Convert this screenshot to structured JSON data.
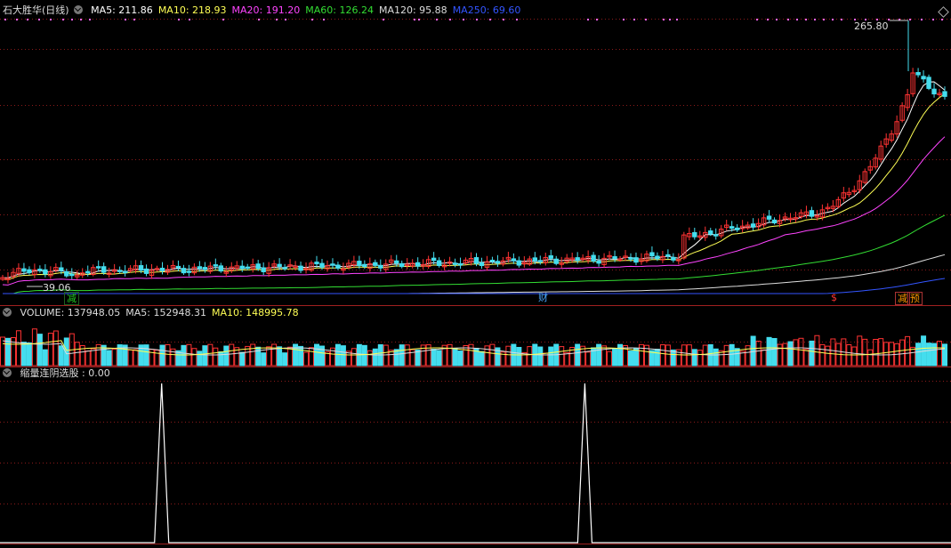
{
  "main_panel": {
    "title": "石大胜华(日线)",
    "indicators": [
      {
        "label": "MA5: 211.86",
        "color": "#ffffff"
      },
      {
        "label": "MA10: 218.93",
        "color": "#ffff55"
      },
      {
        "label": "MA20: 191.20",
        "color": "#ff44ff"
      },
      {
        "label": "MA60: 126.24",
        "color": "#33dd33"
      },
      {
        "label": "MA120: 95.88",
        "color": "#dddddd"
      },
      {
        "label": "MA250: 69.60",
        "color": "#3355ff"
      }
    ],
    "high_label": "265.80",
    "low_label": "39.06",
    "markers": [
      {
        "text": "减",
        "color": "#22cc22"
      },
      {
        "text": "财",
        "color": "#4aa8ff"
      },
      {
        "text": "$",
        "color": "#ff3333"
      },
      {
        "text": "减",
        "color": "#ff9900"
      },
      {
        "text": "预",
        "color": "#ff9900"
      }
    ]
  },
  "volume_panel": {
    "indicators": [
      {
        "label": "VOLUME: 137948.05",
        "color": "#dddddd"
      },
      {
        "label": "MA5: 152948.31",
        "color": "#dddddd"
      },
      {
        "label": "MA10: 148995.78",
        "color": "#ffff55"
      }
    ]
  },
  "signal_panel": {
    "label": "缩量连阴选股 : 0.00",
    "spikes": [
      0.17,
      0.615
    ]
  },
  "colors": {
    "up": "#ff3333",
    "down": "#44ddee",
    "grid": "#8b1a1a"
  }
}
